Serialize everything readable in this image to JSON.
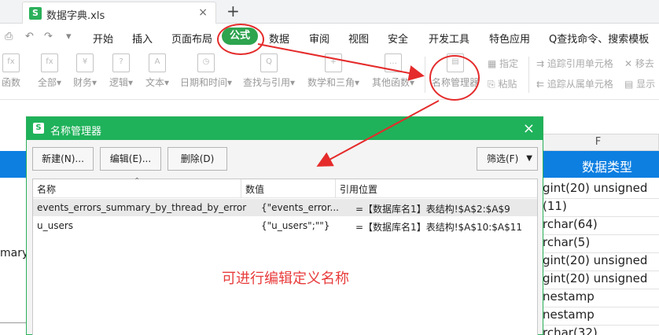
{
  "file_tab": {
    "icon": "S",
    "name": "数据字典.xls",
    "close": "×",
    "add": "+"
  },
  "menu": {
    "items": [
      "开始",
      "插入",
      "页面布局",
      "公式",
      "数据",
      "审阅",
      "视图",
      "安全",
      "开发工具",
      "特色应用"
    ],
    "active": "公式",
    "search": "Q查找命令、搜索模板"
  },
  "toolbar": {
    "groups": [
      {
        "label": "函数",
        "icon": "fx"
      },
      {
        "label": "全部▾",
        "icon": "fx"
      },
      {
        "label": "财务▾",
        "icon": "¥"
      },
      {
        "label": "逻辑▾",
        "icon": "?"
      },
      {
        "label": "文本▾",
        "icon": "A"
      },
      {
        "label": "日期和时间▾",
        "icon": "◷"
      },
      {
        "label": "查找与引用▾",
        "icon": "Q"
      },
      {
        "label": "数学和三角▾",
        "icon": "+"
      },
      {
        "label": "其他函数▾",
        "icon": "…"
      },
      {
        "label": "名称管理器",
        "icon": "▤"
      }
    ],
    "specify": "指定",
    "paste": "粘贴",
    "trace_precedents": "追踪引用单元格",
    "trace_dependents": "追踪从属单元格",
    "remove": "移去",
    "show": "显示"
  },
  "sheet": {
    "col_header": "F",
    "header_title": "数据类型",
    "left_text": "mary",
    "cells": [
      "gint(20) unsigned",
      "(11)",
      "rchar(64)",
      "rchar(5)",
      "gint(20) unsigned",
      "gint(20) unsigned",
      "nestamp",
      "nestamp",
      "rchar(32)"
    ]
  },
  "dialog": {
    "icon": "S",
    "title": "名称管理器",
    "close": "×",
    "buttons": {
      "new": "新建(N)...",
      "edit": "编辑(E)...",
      "delete": "删除(D)",
      "filter": "筛选(F)"
    },
    "columns": {
      "name": "名称",
      "value": "数值",
      "ref": "引用位置"
    },
    "rows": [
      {
        "name": "events_errors_summary_by_thread_by_error",
        "value": "{\"events_error...",
        "ref": "=【数据库名1】表结构!$A$2:$A$9"
      },
      {
        "name": "u_users",
        "value": "{\"u_users\";\"\"}",
        "ref": "=【数据库名1】表结构!$A$10:$A$11"
      }
    ],
    "note": "可进行编辑定义名称"
  },
  "colors": {
    "accent_green": "#1fb25a",
    "header_blue": "#0d7fe1",
    "annotation_red": "#e52b2b"
  }
}
